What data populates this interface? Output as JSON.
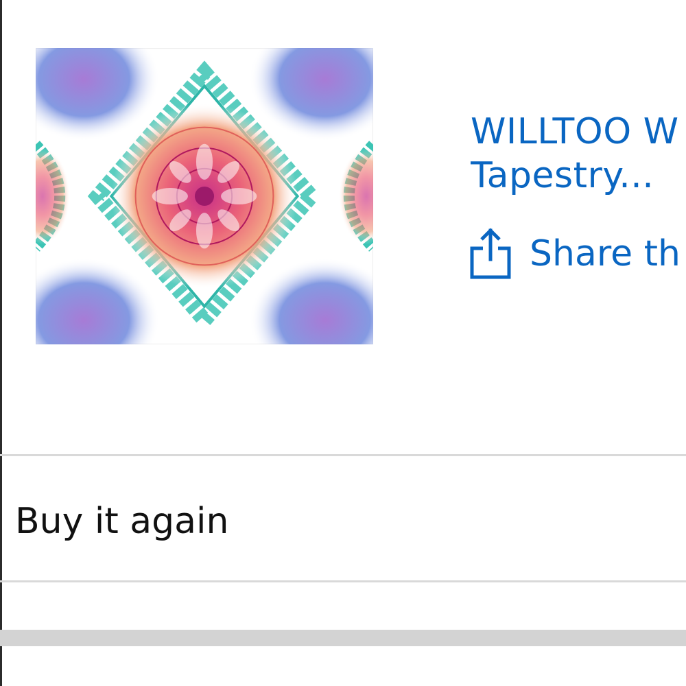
{
  "product": {
    "image_icon": "mandala-tapestry-image",
    "title_line1": "WILLTOO W",
    "title_line2": "Tapestry...",
    "share_icon": "share-icon",
    "share_label": "Share th"
  },
  "sections": {
    "buy_again_label": "Buy it again"
  },
  "colors": {
    "link": "#0a66c2",
    "text": "#111111",
    "divider": "#d9d9d9",
    "bar": "#d3d3d3"
  }
}
